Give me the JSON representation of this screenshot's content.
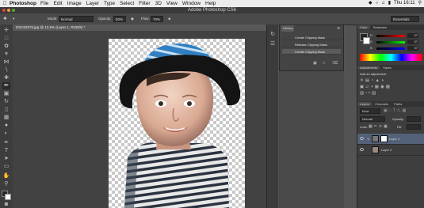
{
  "menubar": {
    "app_name": "Photoshop",
    "items": [
      "File",
      "Edit",
      "Image",
      "Layer",
      "Type",
      "Select",
      "Filter",
      "3D",
      "View",
      "Window",
      "Help"
    ],
    "clock": "Thu 16:11"
  },
  "titlebar": {
    "title": "Adobe Photoshop CS6"
  },
  "options": {
    "mode_label": "Mode:",
    "mode_value": "Normal",
    "opacity_label": "Opacity:",
    "opacity_value": "50%",
    "flow_label": "Flow:",
    "flow_value": "70%",
    "workspace": "Essentials"
  },
  "document": {
    "tab_title": "DSC02076.jpg @ 12.5% (Layer 1, RGB/8) *"
  },
  "history_panel": {
    "tab": "History",
    "entries": [
      "Create Clipping Mask",
      "Release Clipping Mask",
      "Create Clipping Mask"
    ]
  },
  "color_panel": {
    "tabs": [
      "Color",
      "Swatches"
    ],
    "channels": [
      {
        "name": "R",
        "value": "37"
      },
      {
        "name": "G",
        "value": "37"
      },
      {
        "name": "B",
        "value": "37"
      }
    ]
  },
  "adjustments_panel": {
    "tabs": [
      "Adjustments",
      "Styles"
    ],
    "heading": "Add an adjustment"
  },
  "layers_panel": {
    "tabs": [
      "Layers",
      "Channels",
      "Paths"
    ],
    "kind_label": "Kind",
    "blend_mode": "Normal",
    "opacity_label": "Opacity:",
    "lock_label": "Lock:",
    "fill_label": "Fill:",
    "layers": [
      {
        "name": "Layer 1"
      },
      {
        "name": "Layer 2"
      }
    ]
  },
  "colors": {
    "menubar_bg": "#ececec",
    "chrome_dark": "#3a3a3a",
    "selected_layer": "#536278"
  }
}
